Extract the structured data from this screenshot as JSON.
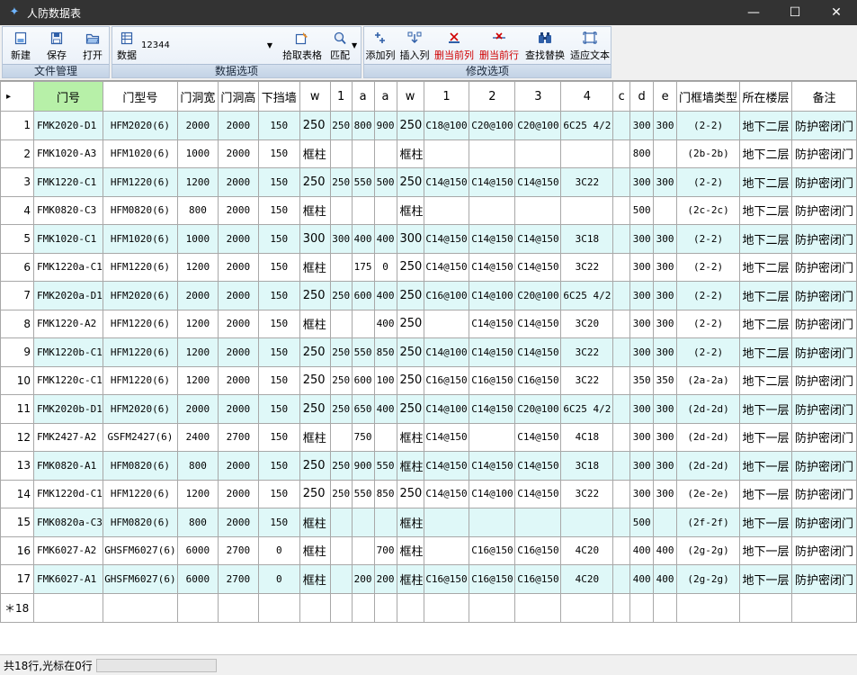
{
  "window": {
    "title": "人防数据表",
    "minimize": "—",
    "maximize": "☐",
    "close": "✕",
    "accent": "#333333"
  },
  "ribbon": {
    "groups": {
      "file": "文件管理",
      "data": "数据选项",
      "edit": "修改选项"
    },
    "file": {
      "new": "新建",
      "save": "保存",
      "open": "打开"
    },
    "data": {
      "data_label": "数据",
      "combo_value": "12344",
      "pick_table": "拾取表格",
      "match": "匹配"
    },
    "edit": {
      "add_col": "添加列",
      "insert_col": "插入列",
      "delete_col": "删当前列",
      "delete_row": "删当前行",
      "find_replace": "查找替换",
      "fit_text": "适应文本"
    }
  },
  "table": {
    "headers": [
      "门号",
      "门型号",
      "门洞宽",
      "门洞高",
      "下挡墙",
      "w",
      "1",
      "a",
      "a",
      "w",
      "1",
      "2",
      "3",
      "4",
      "c",
      "d",
      "e",
      "门框墙类型",
      "所在楼层",
      "备注"
    ],
    "rows": [
      [
        "1",
        "FMK2020-D1",
        "HFM2020(6)",
        "2000",
        "2000",
        "150",
        "250",
        "250",
        "800",
        "900",
        "250",
        "C18@100",
        "C20@100",
        "C20@100",
        "6C25 4/2",
        "",
        "300",
        "300",
        "(2-2)",
        "地下二层",
        "防护密闭门"
      ],
      [
        "2",
        "FMK1020-A3",
        "HFM1020(6)",
        "1000",
        "2000",
        "150",
        "框柱",
        "",
        "",
        "",
        "框柱",
        "",
        "",
        "",
        "",
        "",
        "800",
        "",
        "(2b-2b)",
        "地下二层",
        "防护密闭门"
      ],
      [
        "3",
        "FMK1220-C1",
        "HFM1220(6)",
        "1200",
        "2000",
        "150",
        "250",
        "250",
        "550",
        "500",
        "250",
        "C14@150",
        "C14@150",
        "C14@150",
        "3C22",
        "",
        "300",
        "300",
        "(2-2)",
        "地下二层",
        "防护密闭门"
      ],
      [
        "4",
        "FMK0820-C3",
        "HFM0820(6)",
        "800",
        "2000",
        "150",
        "框柱",
        "",
        "",
        "",
        "框柱",
        "",
        "",
        "",
        "",
        "",
        "500",
        "",
        "(2c-2c)",
        "地下二层",
        "防护密闭门"
      ],
      [
        "5",
        "FMK1020-C1",
        "HFM1020(6)",
        "1000",
        "2000",
        "150",
        "300",
        "300",
        "400",
        "400",
        "300",
        "C14@150",
        "C14@150",
        "C14@150",
        "3C18",
        "",
        "300",
        "300",
        "(2-2)",
        "地下二层",
        "防护密闭门"
      ],
      [
        "6",
        "FMK1220a-C1",
        "HFM1220(6)",
        "1200",
        "2000",
        "150",
        "框柱",
        "",
        "175",
        "0",
        "250",
        "C14@150",
        "C14@150",
        "C14@150",
        "3C22",
        "",
        "300",
        "300",
        "(2-2)",
        "地下二层",
        "防护密闭门"
      ],
      [
        "7",
        "FMK2020a-D1",
        "HFM2020(6)",
        "2000",
        "2000",
        "150",
        "250",
        "250",
        "600",
        "400",
        "250",
        "C16@100",
        "C14@100",
        "C20@100",
        "6C25 4/2",
        "",
        "300",
        "300",
        "(2-2)",
        "地下二层",
        "防护密闭门"
      ],
      [
        "8",
        "FMK1220-A2",
        "HFM1220(6)",
        "1200",
        "2000",
        "150",
        "框柱",
        "",
        "",
        "400",
        "250",
        "",
        "C14@150",
        "C14@150",
        "3C20",
        "",
        "300",
        "300",
        "(2-2)",
        "地下二层",
        "防护密闭门"
      ],
      [
        "9",
        "FMK1220b-C1",
        "HFM1220(6)",
        "1200",
        "2000",
        "150",
        "250",
        "250",
        "550",
        "850",
        "250",
        "C14@100",
        "C14@150",
        "C14@150",
        "3C22",
        "",
        "300",
        "300",
        "(2-2)",
        "地下二层",
        "防护密闭门"
      ],
      [
        "10",
        "FMK1220c-C1",
        "HFM1220(6)",
        "1200",
        "2000",
        "150",
        "250",
        "250",
        "600",
        "100",
        "250",
        "C16@150",
        "C16@150",
        "C16@150",
        "3C22",
        "",
        "350",
        "350",
        "(2a-2a)",
        "地下二层",
        "防护密闭门"
      ],
      [
        "11",
        "FMK2020b-D1",
        "HFM2020(6)",
        "2000",
        "2000",
        "150",
        "250",
        "250",
        "650",
        "400",
        "250",
        "C14@100",
        "C14@150",
        "C20@100",
        "6C25 4/2",
        "",
        "300",
        "300",
        "(2d-2d)",
        "地下一层",
        "防护密闭门"
      ],
      [
        "12",
        "FMK2427-A2",
        "GSFM2427(6)",
        "2400",
        "2700",
        "150",
        "框柱",
        "",
        "750",
        "",
        "框柱",
        "C14@150",
        "",
        "C14@150",
        "4C18",
        "",
        "300",
        "300",
        "(2d-2d)",
        "地下一层",
        "防护密闭门"
      ],
      [
        "13",
        "FMK0820-A1",
        "HFM0820(6)",
        "800",
        "2000",
        "150",
        "250",
        "250",
        "900",
        "550",
        "框柱",
        "C14@150",
        "C14@150",
        "C14@150",
        "3C18",
        "",
        "300",
        "300",
        "(2d-2d)",
        "地下一层",
        "防护密闭门"
      ],
      [
        "14",
        "FMK1220d-C1",
        "HFM1220(6)",
        "1200",
        "2000",
        "150",
        "250",
        "250",
        "550",
        "850",
        "250",
        "C14@150",
        "C14@100",
        "C14@150",
        "3C22",
        "",
        "300",
        "300",
        "(2e-2e)",
        "地下一层",
        "防护密闭门"
      ],
      [
        "15",
        "FMK0820a-C3",
        "HFM0820(6)",
        "800",
        "2000",
        "150",
        "框柱",
        "",
        "",
        "",
        "框柱",
        "",
        "",
        "",
        "",
        "",
        "500",
        "",
        "(2f-2f)",
        "地下一层",
        "防护密闭门"
      ],
      [
        "16",
        "FMK6027-A2",
        "GHSFM6027(6)",
        "6000",
        "2700",
        "0",
        "框柱",
        "",
        "",
        "700",
        "框柱",
        "",
        "C16@150",
        "C16@150",
        "4C20",
        "",
        "400",
        "400",
        "(2g-2g)",
        "地下一层",
        "防护密闭门"
      ],
      [
        "17",
        "FMK6027-A1",
        "GHSFM6027(6)",
        "6000",
        "2700",
        "0",
        "框柱",
        "",
        "200",
        "200",
        "框柱",
        "C16@150",
        "C16@150",
        "C16@150",
        "4C20",
        "",
        "400",
        "400",
        "(2g-2g)",
        "地下一层",
        "防护密闭门"
      ]
    ],
    "new_row_label": "＊18",
    "row_indicator": "▸",
    "header_highlight_color": "#b7f0a8",
    "row_alt_color": "#dff8f8"
  },
  "status": {
    "text": "共18行,光标在0行"
  }
}
